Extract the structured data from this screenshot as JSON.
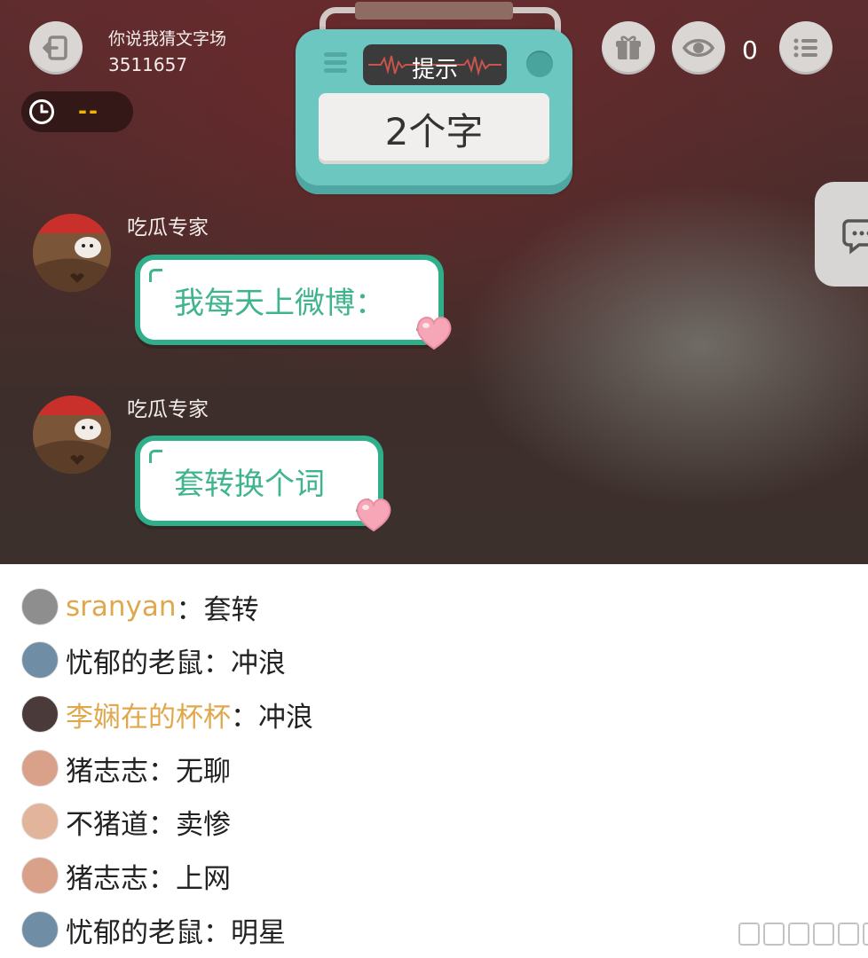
{
  "header": {
    "room_name": "你说我猜文字场",
    "room_id": "3511657",
    "timer_value": "--",
    "viewer_count": "0",
    "icons": {
      "exit": "exit-icon",
      "gift": "gift-icon",
      "eye": "eye-icon",
      "menu": "list-menu-icon",
      "clock": "clock-icon"
    }
  },
  "hint_box": {
    "label": "提示",
    "value": "2个字"
  },
  "messages": [
    {
      "sender": "吃瓜专家",
      "text": "我每天上微博："
    },
    {
      "sender": "吃瓜专家",
      "text": "套转换个词"
    }
  ],
  "guesses": [
    {
      "name": "sranyan",
      "separator": "：",
      "guess": "套转",
      "highlight": true,
      "avatar_color": "#8e8e8e"
    },
    {
      "name": "忧郁的老鼠",
      "separator": "：",
      "guess": "冲浪",
      "highlight": false,
      "avatar_color": "#6f8ea6"
    },
    {
      "name": "李娴在的杯杯",
      "separator": "：",
      "guess": "冲浪",
      "highlight": true,
      "avatar_color": "#4a3a3a"
    },
    {
      "name": "猪志志",
      "separator": "：",
      "guess": "无聊",
      "highlight": false,
      "avatar_color": "#d9a08a"
    },
    {
      "name": "不猪道",
      "separator": "：",
      "guess": "卖惨",
      "highlight": false,
      "avatar_color": "#e2b49c"
    },
    {
      "name": "猪志志",
      "separator": "：",
      "guess": "上网",
      "highlight": false,
      "avatar_color": "#d9a08a"
    },
    {
      "name": "忧郁的老鼠",
      "separator": "：",
      "guess": "明星",
      "highlight": false,
      "avatar_color": "#6f8ea6"
    }
  ],
  "colors": {
    "accent_teal": "#6cc7c1",
    "bubble_green": "#2fae8a",
    "highlight_name": "#e0a84d",
    "timer": "#f4b400"
  }
}
